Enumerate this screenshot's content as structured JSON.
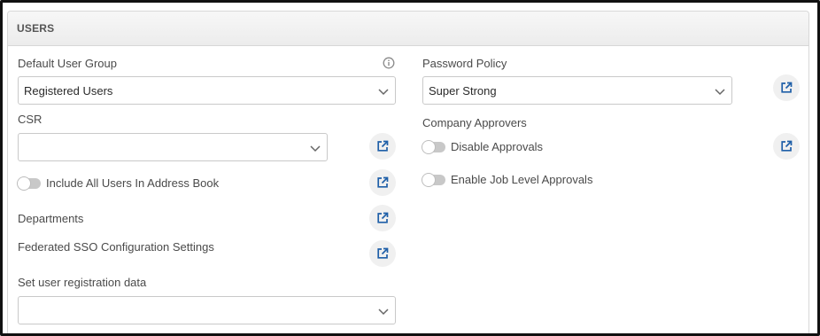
{
  "section": {
    "title": "USERS"
  },
  "left": {
    "default_user_group": {
      "label": "Default User Group",
      "value": "Registered Users"
    },
    "csr": {
      "label": "CSR",
      "value": ""
    },
    "include_all_users": {
      "label": "Include All Users In Address Book",
      "enabled": false
    },
    "departments": {
      "label": "Departments"
    },
    "federated_sso": {
      "label": "Federated SSO Configuration Settings"
    },
    "user_registration": {
      "label": "Set user registration data",
      "value": ""
    }
  },
  "right": {
    "password_policy": {
      "label": "Password Policy",
      "value": "Super Strong"
    },
    "company_approvers": {
      "label": "Company Approvers"
    },
    "disable_approvals": {
      "label": "Disable Approvals",
      "enabled": false
    },
    "job_level_approvals": {
      "label": "Enable Job Level Approvals",
      "enabled": false
    }
  },
  "icons": {
    "external_link": "external-link-icon",
    "chevron": "chevron-down-icon",
    "info": "info-icon"
  },
  "colors": {
    "accent": "#1f5fa8",
    "toggle_off": "#c8c8c8",
    "header_bg": "#efefef"
  }
}
